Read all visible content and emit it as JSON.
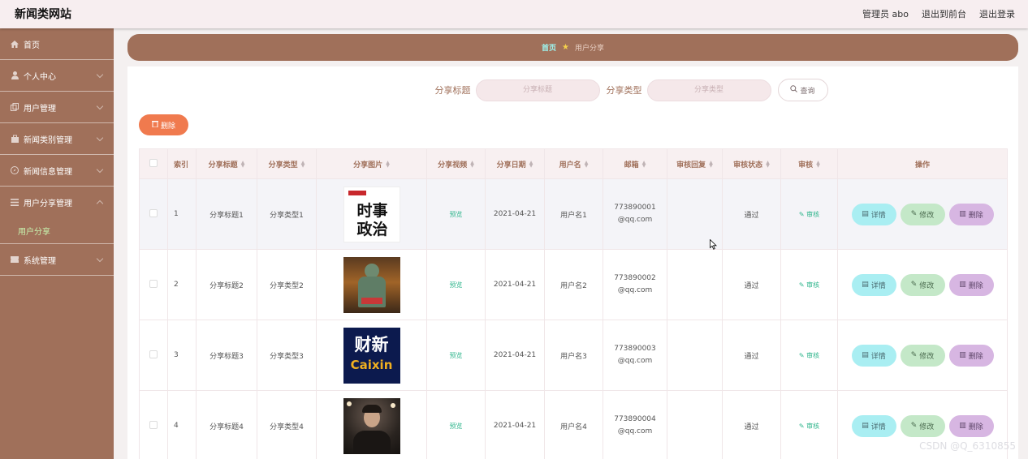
{
  "header": {
    "site_title": "新闻类网站",
    "admin": "管理员 abo",
    "front": "退出到前台",
    "logout": "退出登录"
  },
  "sidebar": {
    "items": [
      {
        "label": "首页",
        "icon": "home-icon"
      },
      {
        "label": "个人中心",
        "icon": "user-icon"
      },
      {
        "label": "用户管理",
        "icon": "copy-icon"
      },
      {
        "label": "新闻类别管理",
        "icon": "bag-icon"
      },
      {
        "label": "新闻信息管理",
        "icon": "compass-icon"
      },
      {
        "label": "用户分享管理",
        "icon": "list-icon"
      },
      {
        "label": "系统管理",
        "icon": "ticket-icon"
      }
    ],
    "submenu_active": "用户分享"
  },
  "breadcrumb": {
    "home": "首页",
    "separator": "★",
    "current": "用户分享"
  },
  "search": {
    "title_label": "分享标题",
    "title_placeholder": "分享标题",
    "type_label": "分享类型",
    "type_placeholder": "分享类型",
    "query_label": "查询"
  },
  "toolbar": {
    "delete_label": "删除"
  },
  "table": {
    "headers": [
      "索引",
      "分享标题",
      "分享类型",
      "分享图片",
      "分享视频",
      "分享日期",
      "用户名",
      "邮箱",
      "审核回复",
      "审核状态",
      "审核",
      "操作"
    ],
    "rows": [
      {
        "index": "1",
        "title": "分享标题1",
        "type": "分享类型1",
        "image": "news-logo-shishi",
        "image_text_top": "时事",
        "image_text_bottom": "政治",
        "video": "预览",
        "date": "2021-04-21",
        "user": "用户名1",
        "email_line1": "773890001",
        "email_line2": "@qq.com",
        "reply": "",
        "status": "通过",
        "audit": "审核"
      },
      {
        "index": "2",
        "title": "分享标题2",
        "type": "分享类型2",
        "image": "statue-photo",
        "video": "预览",
        "date": "2021-04-21",
        "user": "用户名2",
        "email_line1": "773890002",
        "email_line2": "@qq.com",
        "reply": "",
        "status": "通过",
        "audit": "审核"
      },
      {
        "index": "3",
        "title": "分享标题3",
        "type": "分享类型3",
        "image": "caixin-logo",
        "image_text_top": "财新",
        "image_text_bottom": "Caixin",
        "video": "预览",
        "date": "2021-04-21",
        "user": "用户名3",
        "email_line1": "773890003",
        "email_line2": "@qq.com",
        "reply": "",
        "status": "通过",
        "audit": "审核"
      },
      {
        "index": "4",
        "title": "分享标题4",
        "type": "分享类型4",
        "image": "portrait-photo",
        "video": "预览",
        "date": "2021-04-21",
        "user": "用户名4",
        "email_line1": "773890004",
        "email_line2": "@qq.com",
        "reply": "",
        "status": "通过",
        "audit": "审核"
      }
    ],
    "actions": {
      "detail": "详情",
      "edit": "修改",
      "delete": "删除"
    }
  },
  "watermark": "CSDN @Q_6310855",
  "colors": {
    "accent": "#a0705a",
    "delete_button": "#f07a4e",
    "detail": "#a9eef2",
    "edit": "#c4e8c8",
    "remove": "#d7b6e2",
    "link_green": "#2fb58c"
  }
}
